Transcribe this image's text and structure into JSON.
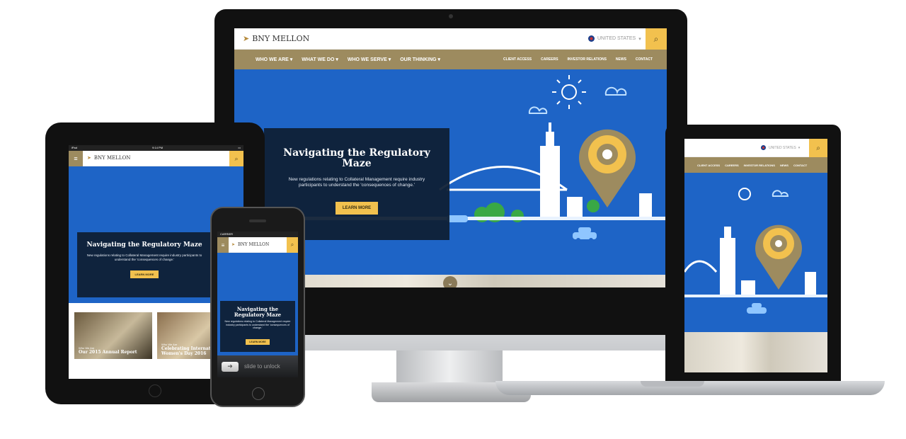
{
  "brand": {
    "name": "BNY MELLON",
    "accent": "#f2c14e",
    "nav_color": "#9d8b5f",
    "hero_color": "#1e64c6"
  },
  "header": {
    "country": "UNITED STATES"
  },
  "nav": {
    "primary": [
      "WHO WE ARE",
      "WHAT WE DO",
      "WHO WE SERVE",
      "OUR THINKING"
    ],
    "secondary": [
      "CLIENT ACCESS",
      "CAREERS",
      "INVESTOR RELATIONS",
      "NEWS",
      "CONTACT"
    ]
  },
  "hero": {
    "title": "Navigating the Regulatory Maze",
    "body": "New regulations relating to Collateral Management require industry participants to understand the 'consequences of change.'",
    "cta": "LEARN MORE"
  },
  "ipad": {
    "status": {
      "carrier": "iPad",
      "time": "9:14 PM"
    },
    "cards": [
      {
        "kicker": "Who We Are",
        "title": "Our 2015 Annual Report"
      },
      {
        "kicker": "Who We Are",
        "title": "Celebrating International Women's Day 2016"
      }
    ]
  },
  "phone": {
    "status": {
      "carrier": "CARRIER"
    },
    "slide_label": "slide to unlock"
  },
  "icons": [
    "brand-arrow-icon",
    "search-icon",
    "flag-icon",
    "chevron-down-icon",
    "hamburger-icon",
    "slide-arrow-icon",
    "sun-icon",
    "cloud-icon",
    "location-pin-icon",
    "car-icon"
  ]
}
